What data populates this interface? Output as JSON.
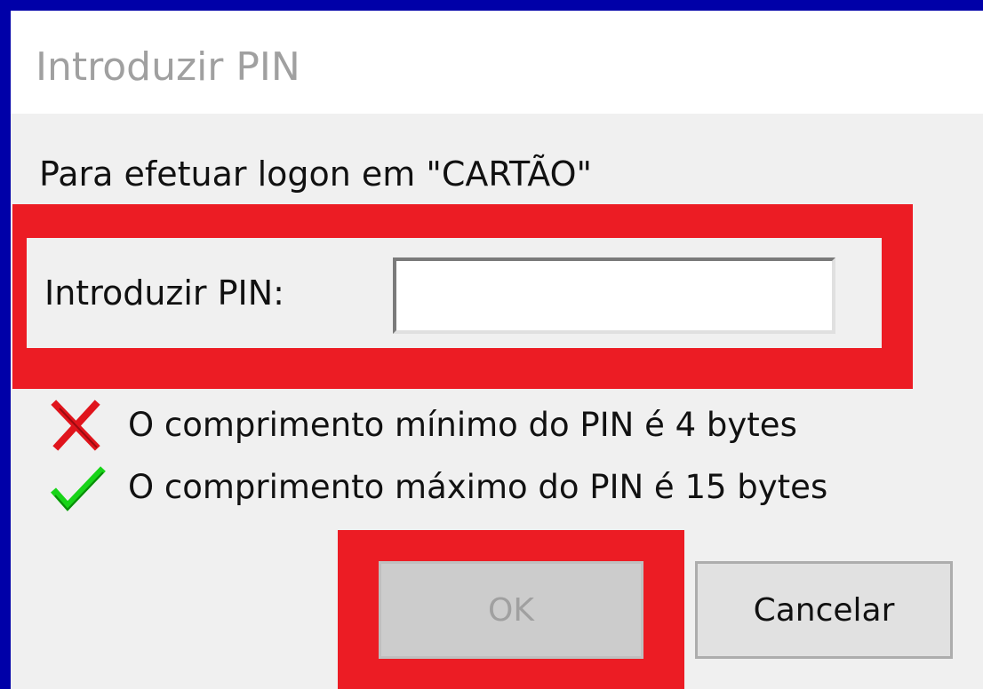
{
  "dialog": {
    "title": "Introduzir PIN",
    "prompt": "Para efetuar logon em \"CARTÃO\"",
    "pin_label": "Introduzir PIN:",
    "pin_value": "",
    "rules": [
      {
        "icon": "red-x-icon",
        "status": "fail",
        "text": "O comprimento mínimo do PIN é 4 bytes"
      },
      {
        "icon": "green-check-icon",
        "status": "pass",
        "text": "O comprimento máximo do PIN é 15 bytes"
      }
    ],
    "buttons": {
      "ok_label": "OK",
      "ok_enabled": false,
      "cancel_label": "Cancelar"
    }
  },
  "colors": {
    "background": "#0000a8",
    "highlight": "#ec1c24",
    "dialog": "#f0f0f0",
    "fail": "#e0141c",
    "pass": "#18d418"
  }
}
